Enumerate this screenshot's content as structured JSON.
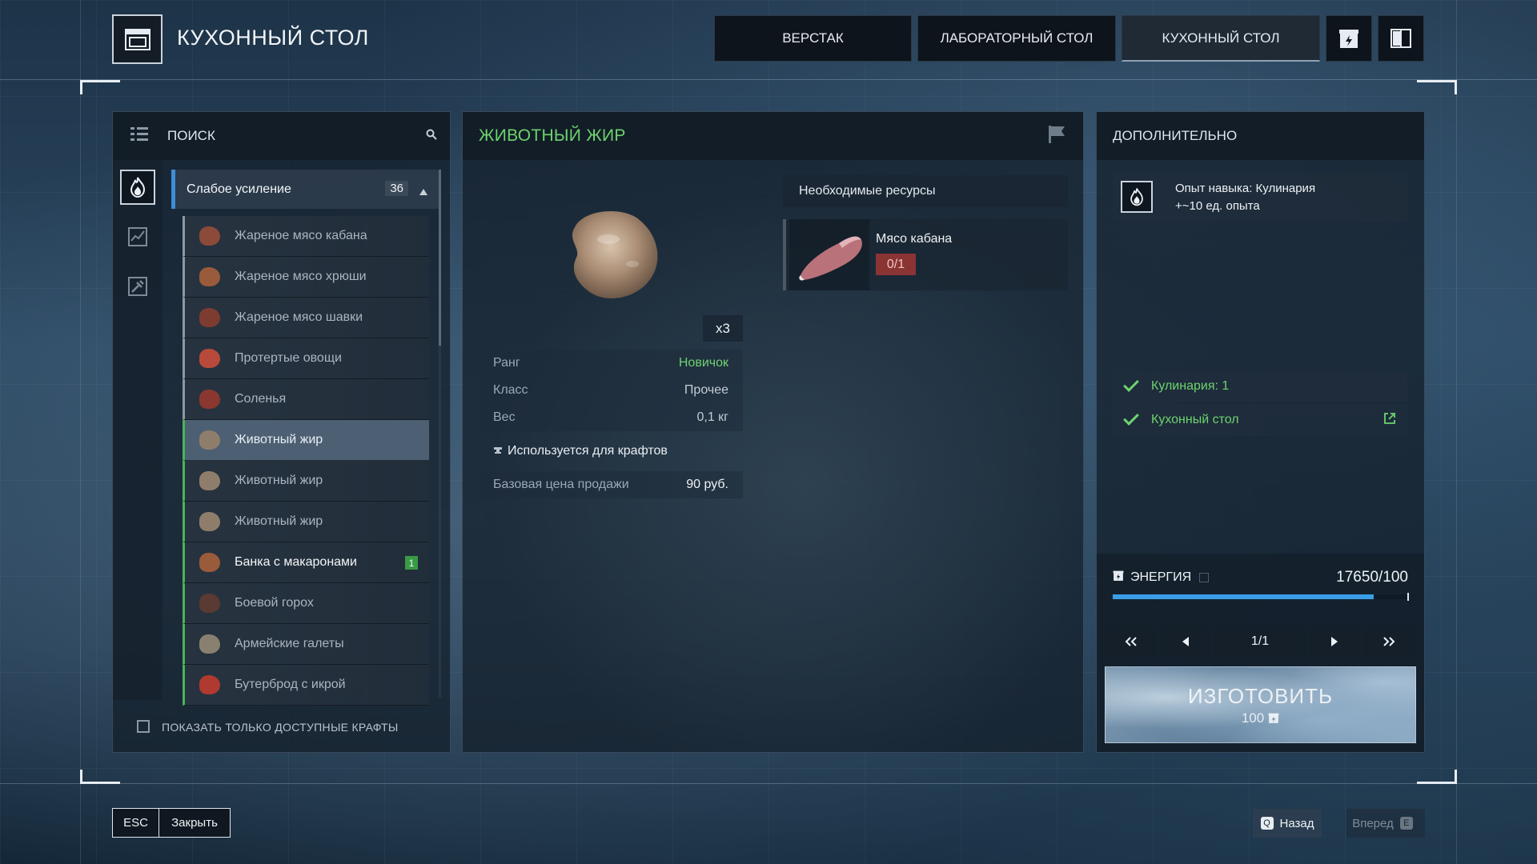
{
  "header": {
    "title": "КУХОННЫЙ СТОЛ",
    "tabs": [
      {
        "label": "ВЕРСТАК",
        "active": false
      },
      {
        "label": "ЛАБОРАТОРНЫЙ СТОЛ",
        "active": false
      },
      {
        "label": "КУХОННЫЙ СТОЛ",
        "active": true
      }
    ],
    "icons": [
      "energy-box-icon",
      "book-icon"
    ]
  },
  "left_panel": {
    "search_label": "ПОИСК",
    "group": {
      "label": "Слабое усиление",
      "count": "36"
    },
    "recipes": [
      {
        "label": "Жареное мясо кабана",
        "available": false,
        "selected": false,
        "color": "#8b4a3a"
      },
      {
        "label": "Жареное мясо хрюши",
        "available": false,
        "selected": false,
        "color": "#9a5a3c"
      },
      {
        "label": "Жареное мясо шавки",
        "available": false,
        "selected": false,
        "color": "#7e3b30"
      },
      {
        "label": "Протертые овощи",
        "available": false,
        "selected": false,
        "color": "#b84a3c"
      },
      {
        "label": "Соленья",
        "available": false,
        "selected": false,
        "color": "#8a3730"
      },
      {
        "label": "Животный жир",
        "available": true,
        "selected": true,
        "color": "#8f7d6c"
      },
      {
        "label": "Животный жир",
        "available": true,
        "selected": false,
        "color": "#8f7d6c"
      },
      {
        "label": "Животный жир",
        "available": true,
        "selected": false,
        "color": "#8f7d6c"
      },
      {
        "label": "Банка с макаронами",
        "available": true,
        "selected": false,
        "bright": true,
        "badge": "1",
        "color": "#9a5b3a"
      },
      {
        "label": "Боевой горох",
        "available": true,
        "selected": false,
        "color": "#5a3a32"
      },
      {
        "label": "Армейские галеты",
        "available": true,
        "selected": false,
        "color": "#8a8070"
      },
      {
        "label": "Бутерброд с икрой",
        "available": true,
        "selected": false,
        "color": "#b03a30"
      }
    ],
    "filter_label": "ПОКАЗАТЬ ТОЛЬКО ДОСТУПНЫЕ КРАФТЫ"
  },
  "center_panel": {
    "item_title": "ЖИВОТНЫЙ ЖИР",
    "quantity": "х3",
    "stats": [
      {
        "label": "Ранг",
        "value": "Новичок",
        "value_color": "#6ed36f"
      },
      {
        "label": "Класс",
        "value": "Прочее",
        "value_color": "#c4ccd4"
      },
      {
        "label": "Вес",
        "value": "0,1 кг",
        "value_color": "#c4ccd4"
      }
    ],
    "used_for": "Используется для крафтов",
    "price_label": "Базовая цена продажи",
    "price_value": "90 руб.",
    "resources_header": "Необходимые ресурсы",
    "resources": [
      {
        "name": "Мясо кабана",
        "amount": "0/1"
      }
    ]
  },
  "right_panel": {
    "header": "ДОПОЛНИТЕЛЬНО",
    "xp_line1": "Опыт навыка: Кулинария",
    "xp_line2": "+~10 ед. опыта",
    "requirements": [
      {
        "label": "Кулинария: 1",
        "link": false
      },
      {
        "label": "Кухонный стол",
        "link": true
      }
    ],
    "energy_label": "ЭНЕРГИЯ",
    "energy_value": "17650/100",
    "energy_fill": 0.88,
    "page": "1/1",
    "craft_label": "ИЗГОТОВИТЬ",
    "craft_cost": "100"
  },
  "footer": {
    "esc_key": "ESC",
    "close_label": "Закрыть",
    "back_key": "Q",
    "back_label": "Назад",
    "forward_label": "Вперед",
    "forward_key": "E"
  }
}
